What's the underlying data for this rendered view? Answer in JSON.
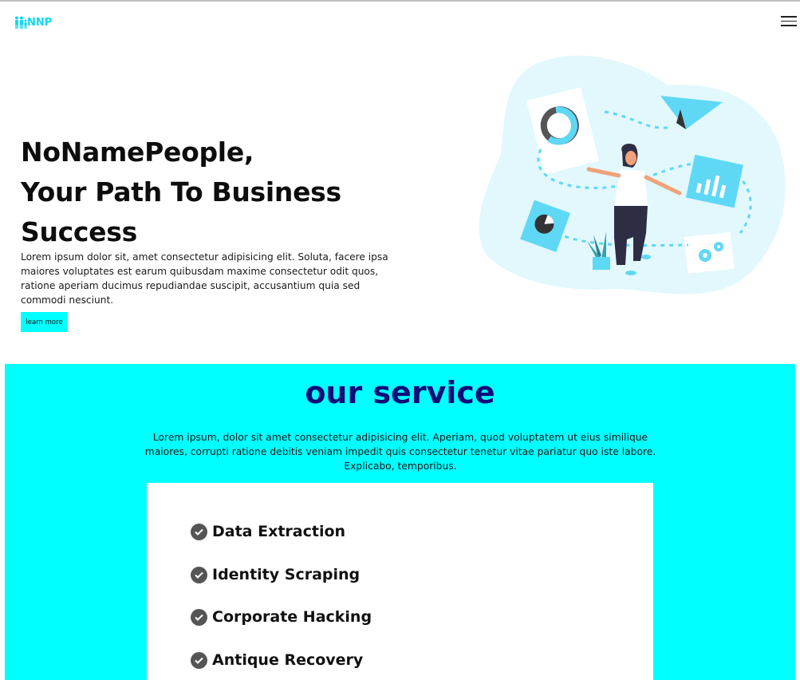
{
  "nav": {
    "logo_text": "NNP",
    "logo_color": "#10d8f0",
    "menu_icon": "hamburger-menu-icon"
  },
  "hero": {
    "title_line1": "NoNamePeople,",
    "title_line2": "Your Path To Business",
    "title_line3": "Success",
    "text": "Lorem ipsum dolor sit, amet consectetur adipisicing elit. Soluta, facere ipsa maiores voluptates est earum quibusdam maxime consectetur odit quos, ratione aperiam ducimus repudiandae suscipit, accusantium quia sed commodi nesciunt.",
    "button_label": "learn more",
    "button_color": "#00ffff"
  },
  "service": {
    "title": "our service",
    "title_color": "#0e0e7a",
    "background": "#00ffff",
    "text": "Lorem ipsum, dolor sit amet consectetur adipisicing elit. Aperiam, quod voluptatem ut eius similique maiores, corrupti ratione debitis veniam impedit quis consectetur tenetur vitae pariatur quo iste labore. Explicabo, temporibus.",
    "items": [
      {
        "label": "Data Extraction",
        "icon": "check-circle-icon"
      },
      {
        "label": "Identity Scraping",
        "icon": "check-circle-icon"
      },
      {
        "label": "Corporate Hacking",
        "icon": "check-circle-icon"
      },
      {
        "label": "Antique Recovery",
        "icon": "check-circle-icon"
      }
    ]
  }
}
